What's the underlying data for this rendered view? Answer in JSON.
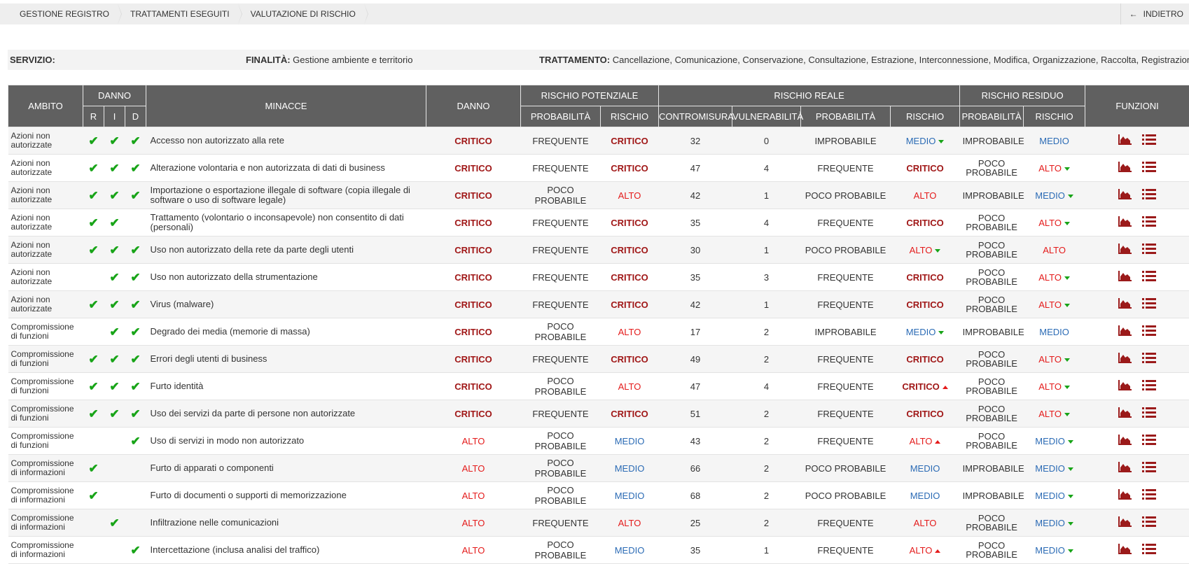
{
  "breadcrumb": [
    "GESTIONE REGISTRO",
    "TRATTAMENTI ESEGUITI",
    "VALUTAZIONE DI RISCHIO"
  ],
  "back_label": "INDIETRO",
  "info": {
    "servizio_label": "SERVIZIO:",
    "servizio_value": "",
    "finalita_label": "FINALITÀ:",
    "finalita_value": "Gestione ambiente e territorio",
    "trattamento_label": "TRATTAMENTO:",
    "trattamento_value": "Cancellazione, Comunicazione, Conservazione, Consultazione, Estrazione, Interconnessione, Modifica, Organizzazione, Raccolta, Registrazione, Uso,"
  },
  "headers": {
    "ambito": "AMBITO",
    "danno_group": "DANNO",
    "r": "R",
    "i": "I",
    "d": "D",
    "minacce": "MINACCE",
    "danno": "DANNO",
    "rischio_potenziale": "RISCHIO POTENZIALE",
    "rischio_reale": "RISCHIO REALE",
    "rischio_residuo": "RISCHIO RESIDUO",
    "funzioni": "FUNZIONI",
    "probabilita": "PROBABILITÀ",
    "rischio": "RISCHIO",
    "contromisura": "CONTROMISURA",
    "vulnerabilita": "VULNERABILITÀ"
  },
  "check_glyph": "✔",
  "rows": [
    {
      "ambito": "Azioni non autorizzate",
      "r": true,
      "i": true,
      "d": true,
      "minaccia": "Accesso non autorizzato alla rete",
      "danno": "CRITICO",
      "pot_prob": "FREQUENTE",
      "pot_rischio": "CRITICO",
      "contromisura": "32",
      "vulnerabilita": "0",
      "real_prob": "IMPROBABILE",
      "real_rischio": "MEDIO",
      "real_trend": "down",
      "res_prob": "IMPROBABILE",
      "res_rischio": "MEDIO",
      "res_trend": ""
    },
    {
      "ambito": "Azioni non autorizzate",
      "r": true,
      "i": true,
      "d": true,
      "minaccia": "Alterazione volontaria e non autorizzata di dati di business",
      "danno": "CRITICO",
      "pot_prob": "FREQUENTE",
      "pot_rischio": "CRITICO",
      "contromisura": "47",
      "vulnerabilita": "4",
      "real_prob": "FREQUENTE",
      "real_rischio": "CRITICO",
      "real_trend": "",
      "res_prob": "POCO PROBABILE",
      "res_rischio": "ALTO",
      "res_trend": "down"
    },
    {
      "ambito": "Azioni non autorizzate",
      "r": true,
      "i": true,
      "d": true,
      "minaccia": "Importazione o esportazione illegale di software (copia illegale di software o uso di software legale)",
      "danno": "CRITICO",
      "pot_prob": "POCO PROBABILE",
      "pot_rischio": "ALTO",
      "contromisura": "42",
      "vulnerabilita": "1",
      "real_prob": "POCO PROBABILE",
      "real_rischio": "ALTO",
      "real_trend": "",
      "res_prob": "IMPROBABILE",
      "res_rischio": "MEDIO",
      "res_trend": "down"
    },
    {
      "ambito": "Azioni non autorizzate",
      "r": true,
      "i": true,
      "d": false,
      "minaccia": "Trattamento (volontario o inconsapevole) non consentito di dati (personali)",
      "danno": "CRITICO",
      "pot_prob": "FREQUENTE",
      "pot_rischio": "CRITICO",
      "contromisura": "35",
      "vulnerabilita": "4",
      "real_prob": "FREQUENTE",
      "real_rischio": "CRITICO",
      "real_trend": "",
      "res_prob": "POCO PROBABILE",
      "res_rischio": "ALTO",
      "res_trend": "down"
    },
    {
      "ambito": "Azioni non autorizzate",
      "r": true,
      "i": true,
      "d": true,
      "minaccia": "Uso non autorizzato della rete da parte degli utenti",
      "danno": "CRITICO",
      "pot_prob": "FREQUENTE",
      "pot_rischio": "CRITICO",
      "contromisura": "30",
      "vulnerabilita": "1",
      "real_prob": "POCO PROBABILE",
      "real_rischio": "ALTO",
      "real_trend": "down",
      "res_prob": "POCO PROBABILE",
      "res_rischio": "ALTO",
      "res_trend": ""
    },
    {
      "ambito": "Azioni non autorizzate",
      "r": false,
      "i": true,
      "d": true,
      "minaccia": "Uso non autorizzato della strumentazione",
      "danno": "CRITICO",
      "pot_prob": "FREQUENTE",
      "pot_rischio": "CRITICO",
      "contromisura": "35",
      "vulnerabilita": "3",
      "real_prob": "FREQUENTE",
      "real_rischio": "CRITICO",
      "real_trend": "",
      "res_prob": "POCO PROBABILE",
      "res_rischio": "ALTO",
      "res_trend": "down"
    },
    {
      "ambito": "Azioni non autorizzate",
      "r": true,
      "i": true,
      "d": true,
      "minaccia": "Virus (malware)",
      "danno": "CRITICO",
      "pot_prob": "FREQUENTE",
      "pot_rischio": "CRITICO",
      "contromisura": "42",
      "vulnerabilita": "1",
      "real_prob": "FREQUENTE",
      "real_rischio": "CRITICO",
      "real_trend": "",
      "res_prob": "POCO PROBABILE",
      "res_rischio": "ALTO",
      "res_trend": "down"
    },
    {
      "ambito": "Compromissione di funzioni",
      "r": false,
      "i": true,
      "d": true,
      "minaccia": "Degrado dei media (memorie di massa)",
      "danno": "CRITICO",
      "pot_prob": "POCO PROBABILE",
      "pot_rischio": "ALTO",
      "contromisura": "17",
      "vulnerabilita": "2",
      "real_prob": "IMPROBABILE",
      "real_rischio": "MEDIO",
      "real_trend": "down",
      "res_prob": "IMPROBABILE",
      "res_rischio": "MEDIO",
      "res_trend": ""
    },
    {
      "ambito": "Compromissione di funzioni",
      "r": true,
      "i": true,
      "d": true,
      "minaccia": "Errori degli utenti di business",
      "danno": "CRITICO",
      "pot_prob": "FREQUENTE",
      "pot_rischio": "CRITICO",
      "contromisura": "49",
      "vulnerabilita": "2",
      "real_prob": "FREQUENTE",
      "real_rischio": "CRITICO",
      "real_trend": "",
      "res_prob": "POCO PROBABILE",
      "res_rischio": "ALTO",
      "res_trend": "down"
    },
    {
      "ambito": "Compromissione di funzioni",
      "r": true,
      "i": true,
      "d": true,
      "minaccia": "Furto identità",
      "danno": "CRITICO",
      "pot_prob": "POCO PROBABILE",
      "pot_rischio": "ALTO",
      "contromisura": "47",
      "vulnerabilita": "4",
      "real_prob": "FREQUENTE",
      "real_rischio": "CRITICO",
      "real_trend": "up",
      "res_prob": "POCO PROBABILE",
      "res_rischio": "ALTO",
      "res_trend": "down"
    },
    {
      "ambito": "Compromissione di funzioni",
      "r": true,
      "i": true,
      "d": true,
      "minaccia": "Uso dei servizi da parte di persone non autorizzate",
      "danno": "CRITICO",
      "pot_prob": "FREQUENTE",
      "pot_rischio": "CRITICO",
      "contromisura": "51",
      "vulnerabilita": "2",
      "real_prob": "FREQUENTE",
      "real_rischio": "CRITICO",
      "real_trend": "",
      "res_prob": "POCO PROBABILE",
      "res_rischio": "ALTO",
      "res_trend": "down"
    },
    {
      "ambito": "Compromissione di funzioni",
      "r": false,
      "i": false,
      "d": true,
      "minaccia": "Uso di servizi in modo non autorizzato",
      "danno": "ALTO",
      "pot_prob": "POCO PROBABILE",
      "pot_rischio": "MEDIO",
      "contromisura": "43",
      "vulnerabilita": "2",
      "real_prob": "FREQUENTE",
      "real_rischio": "ALTO",
      "real_trend": "up",
      "res_prob": "POCO PROBABILE",
      "res_rischio": "MEDIO",
      "res_trend": "down"
    },
    {
      "ambito": "Compromissione di informazioni",
      "r": true,
      "i": false,
      "d": false,
      "minaccia": "Furto di apparati o componenti",
      "danno": "ALTO",
      "pot_prob": "POCO PROBABILE",
      "pot_rischio": "MEDIO",
      "contromisura": "66",
      "vulnerabilita": "2",
      "real_prob": "POCO PROBABILE",
      "real_rischio": "MEDIO",
      "real_trend": "",
      "res_prob": "IMPROBABILE",
      "res_rischio": "MEDIO",
      "res_trend": "down"
    },
    {
      "ambito": "Compromissione di informazioni",
      "r": true,
      "i": false,
      "d": false,
      "minaccia": "Furto di documenti o supporti di memorizzazione",
      "danno": "ALTO",
      "pot_prob": "POCO PROBABILE",
      "pot_rischio": "MEDIO",
      "contromisura": "68",
      "vulnerabilita": "2",
      "real_prob": "POCO PROBABILE",
      "real_rischio": "MEDIO",
      "real_trend": "",
      "res_prob": "IMPROBABILE",
      "res_rischio": "MEDIO",
      "res_trend": "down"
    },
    {
      "ambito": "Compromissione di informazioni",
      "r": false,
      "i": true,
      "d": false,
      "minaccia": "Infiltrazione nelle comunicazioni",
      "danno": "ALTO",
      "pot_prob": "FREQUENTE",
      "pot_rischio": "ALTO",
      "contromisura": "25",
      "vulnerabilita": "2",
      "real_prob": "FREQUENTE",
      "real_rischio": "ALTO",
      "real_trend": "",
      "res_prob": "POCO PROBABILE",
      "res_rischio": "MEDIO",
      "res_trend": "down"
    },
    {
      "ambito": "Compromissione di informazioni",
      "r": false,
      "i": false,
      "d": true,
      "minaccia": "Intercettazione (inclusa analisi del traffico)",
      "danno": "ALTO",
      "pot_prob": "POCO PROBABILE",
      "pot_rischio": "MEDIO",
      "contromisura": "35",
      "vulnerabilita": "1",
      "real_prob": "FREQUENTE",
      "real_rischio": "ALTO",
      "real_trend": "up",
      "res_prob": "POCO PROBABILE",
      "res_rischio": "MEDIO",
      "res_trend": "down"
    }
  ],
  "colors": {
    "critico": "#a01717",
    "alto": "#e41b1b",
    "medio": "#2b6bb5",
    "check": "#18a418",
    "header_bg": "#606060",
    "icon": "#9b1a1a"
  },
  "icons": {
    "function_chart": "area-chart-icon",
    "function_list": "list-icon",
    "back": "arrow-left-icon"
  }
}
